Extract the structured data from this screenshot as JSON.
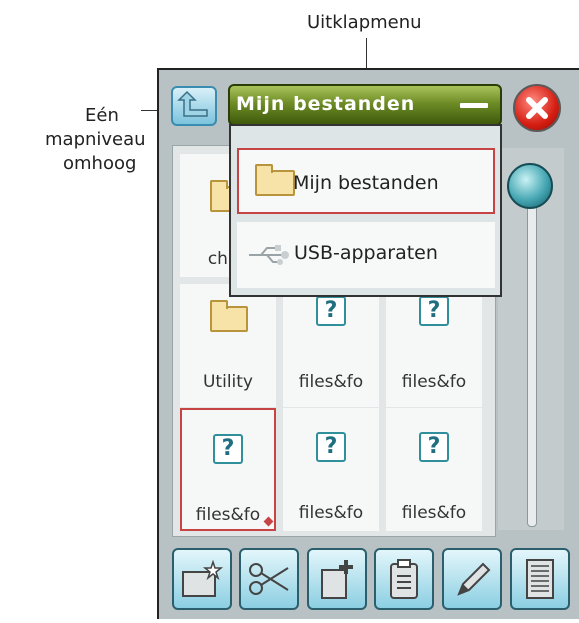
{
  "annotations": {
    "dropdown_label": "Uitklapmenu",
    "up_label_lines": [
      "Eén",
      "mapniveau",
      "omhoog"
    ]
  },
  "titlebar": {
    "title": "Mijn bestanden"
  },
  "dropdown": {
    "items": [
      {
        "label": "Mijn bestanden",
        "icon": "folder-icon",
        "selected": true
      },
      {
        "label": "USB-apparaten",
        "icon": "usb-icon",
        "selected": false
      }
    ]
  },
  "grid": {
    "tiles": [
      {
        "label": "child",
        "icon": "folder-icon"
      },
      {
        "label": "Utility",
        "icon": "folder-icon"
      },
      {
        "label": "files&fo",
        "icon": "unknown-file-icon"
      },
      {
        "label": "files&fo",
        "icon": "unknown-file-icon"
      },
      {
        "label": "files&fo",
        "icon": "unknown-file-icon",
        "selected": true
      },
      {
        "label": "files&fo",
        "icon": "unknown-file-icon"
      },
      {
        "label": "files&fo",
        "icon": "unknown-file-icon"
      }
    ]
  },
  "toolbar": {
    "buttons": [
      {
        "name": "new-folder",
        "icon": "new-folder-icon"
      },
      {
        "name": "cut",
        "icon": "scissors-icon"
      },
      {
        "name": "new-file",
        "icon": "new-file-icon"
      },
      {
        "name": "paste",
        "icon": "clipboard-icon"
      },
      {
        "name": "rename",
        "icon": "pencil-icon"
      },
      {
        "name": "details",
        "icon": "document-list-icon"
      }
    ]
  },
  "colors": {
    "titlebar": "#6e8c26",
    "accent": "#46a7b3",
    "close": "#d61e12",
    "selection": "#c74444"
  }
}
